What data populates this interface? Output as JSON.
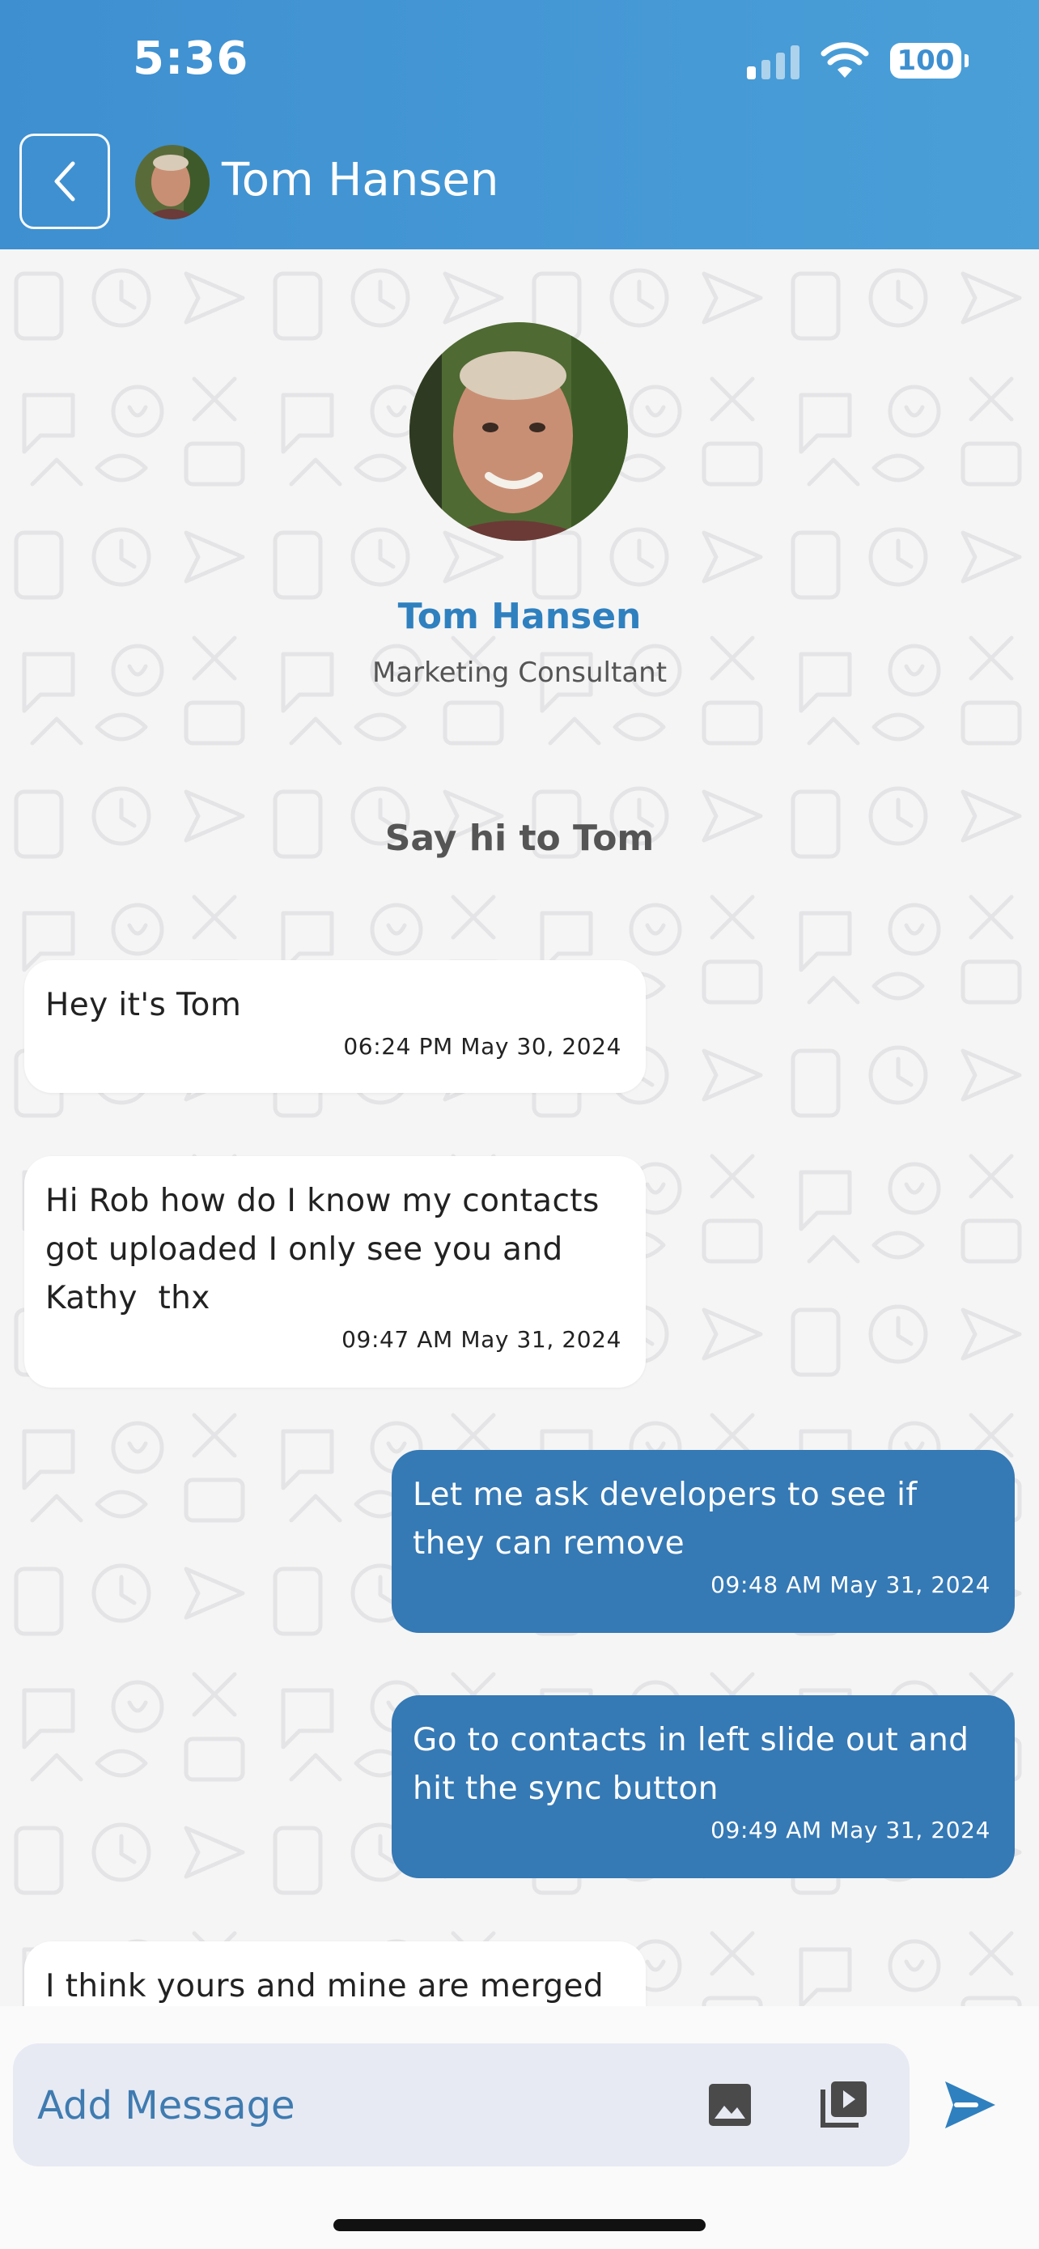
{
  "status_bar": {
    "time": "5:36",
    "battery": "100"
  },
  "header": {
    "contact_name": "Tom Hansen"
  },
  "profile": {
    "name": "Tom Hansen",
    "role": "Marketing Consultant",
    "greeting": "Say hi to Tom"
  },
  "messages": [
    {
      "direction": "incoming",
      "text": "Hey it's Tom",
      "time": "06:24 PM May 30, 2024"
    },
    {
      "direction": "incoming",
      "text": "Hi Rob how do I know my contacts got uploaded I only see you and Kathy  thx",
      "time": "09:47 AM May 31, 2024"
    },
    {
      "direction": "outgoing",
      "text": "Let me ask developers to see if they can remove",
      "time": "09:48 AM May 31, 2024"
    },
    {
      "direction": "outgoing",
      "text": "Go to contacts in left slide out and hit the sync button",
      "time": "09:49 AM May 31, 2024"
    },
    {
      "direction": "incoming",
      "text": "I think yours and mine are merged",
      "time": ""
    }
  ],
  "composer": {
    "placeholder": "Add Message"
  },
  "colors": {
    "header": "#4a9fd8",
    "outgoing_bubble": "#3579b5",
    "incoming_bubble": "#ffffff",
    "accent": "#2f80bf"
  },
  "icons": {
    "back": "chevron-left-icon",
    "image": "image-icon",
    "video": "video-library-icon",
    "send": "send-icon"
  }
}
